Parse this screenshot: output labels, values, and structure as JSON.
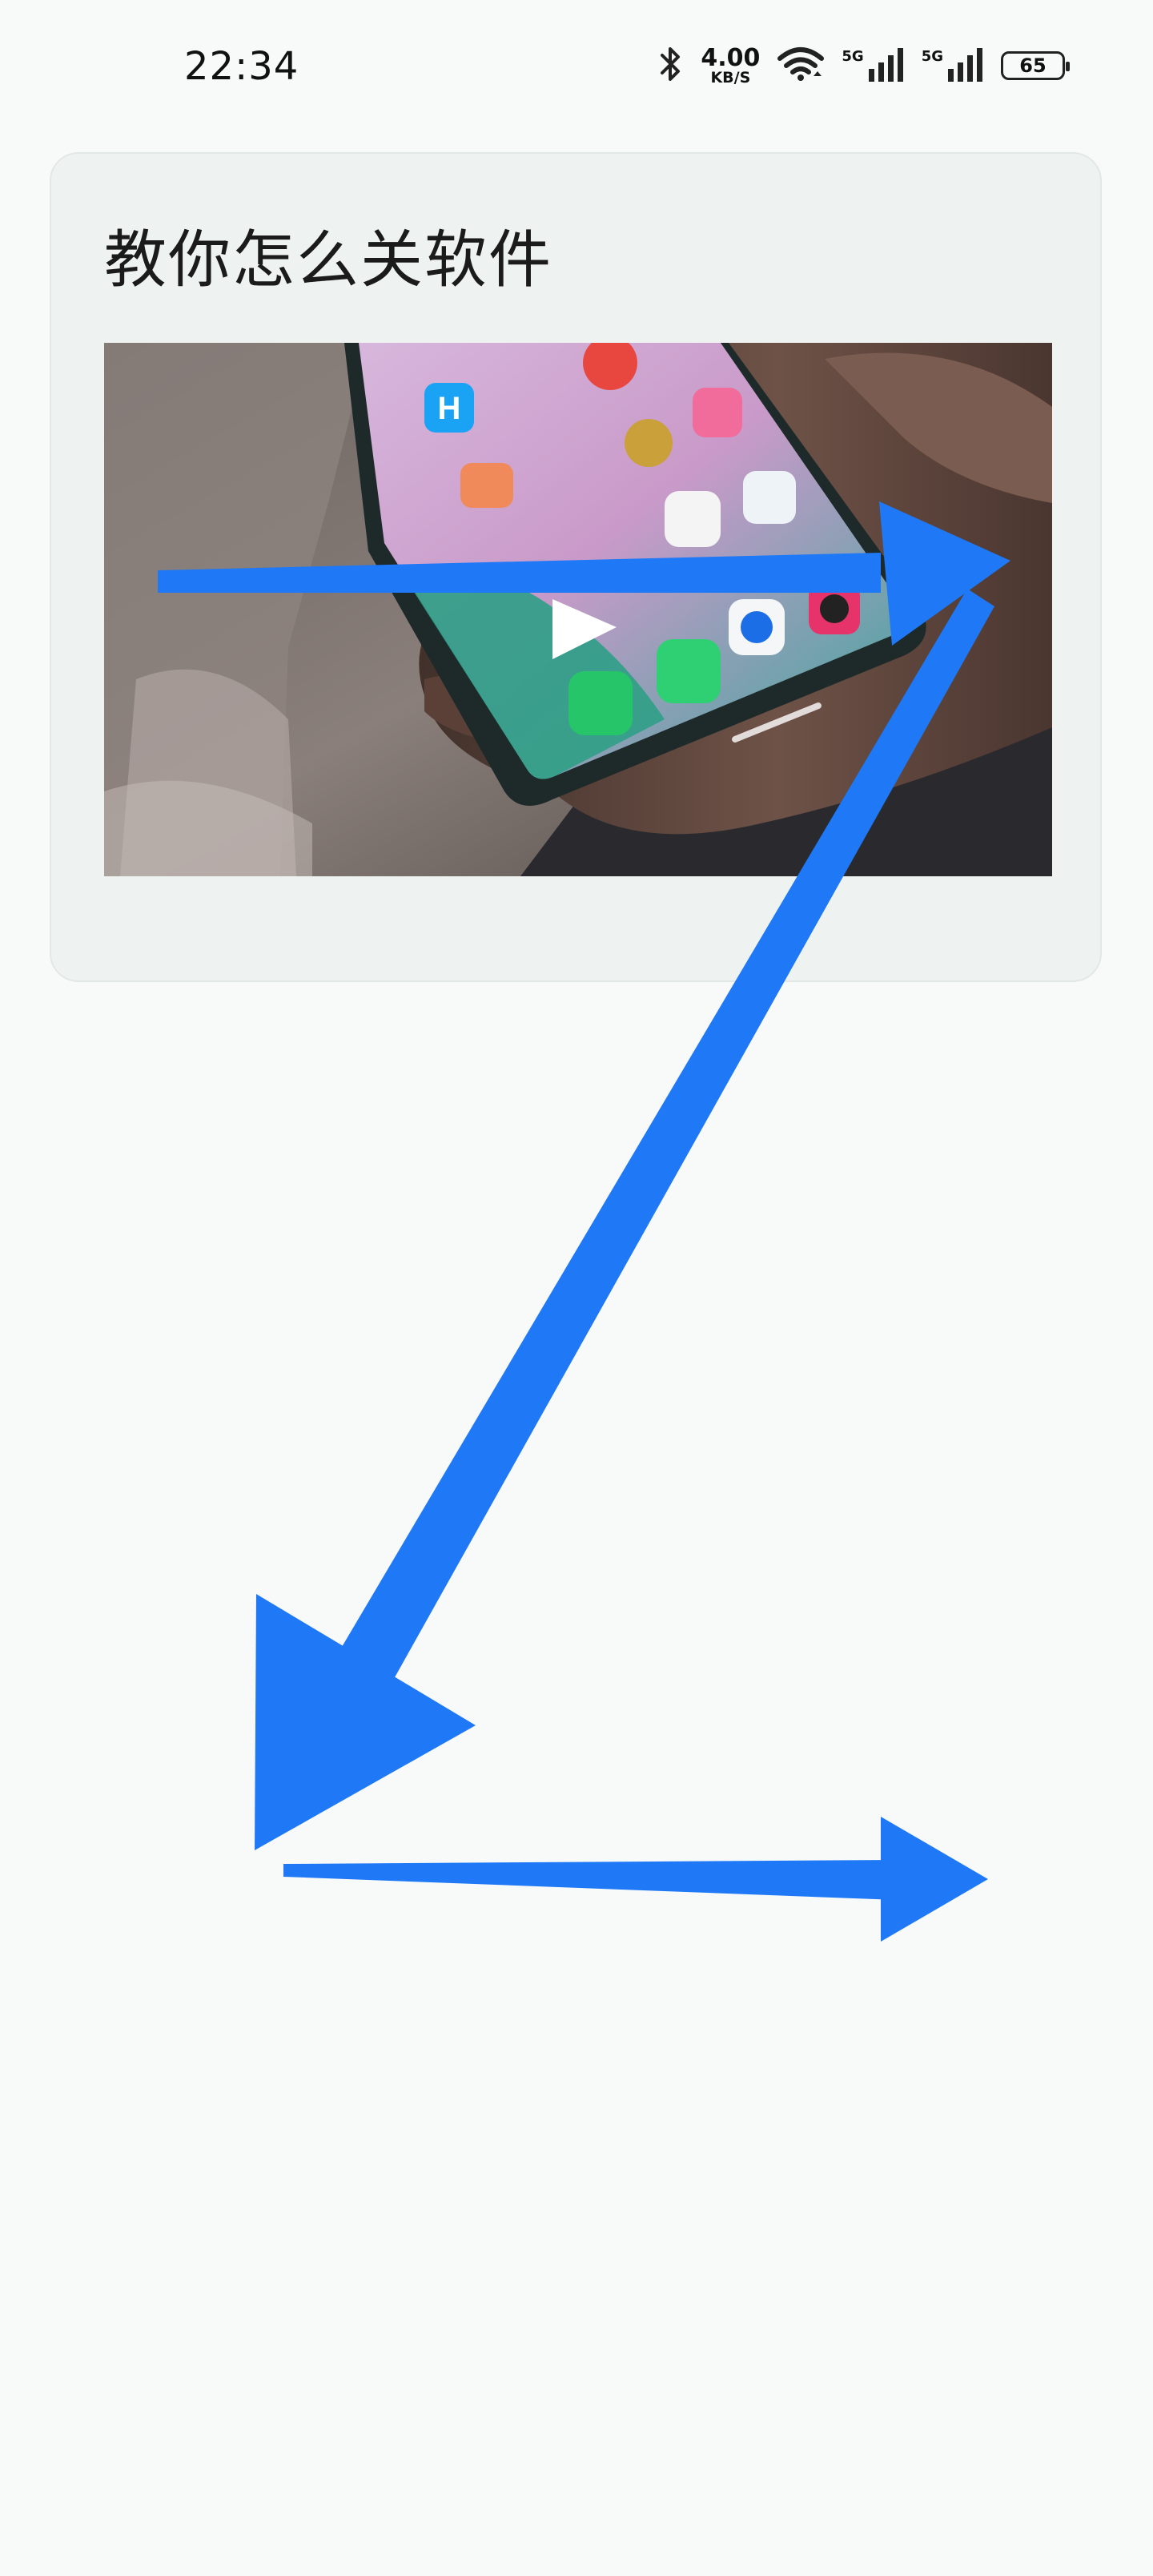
{
  "status_bar": {
    "time": "22:34",
    "network_speed_value": "4.00",
    "network_speed_unit": "KB/S",
    "sim1_tag": "5G",
    "sim2_tag": "5G",
    "battery": "65"
  },
  "post": {
    "title": "教你怎么关软件"
  },
  "colors": {
    "arrow": "#1f78f5",
    "background": "#f8fafa",
    "card": "#eef3f2"
  }
}
